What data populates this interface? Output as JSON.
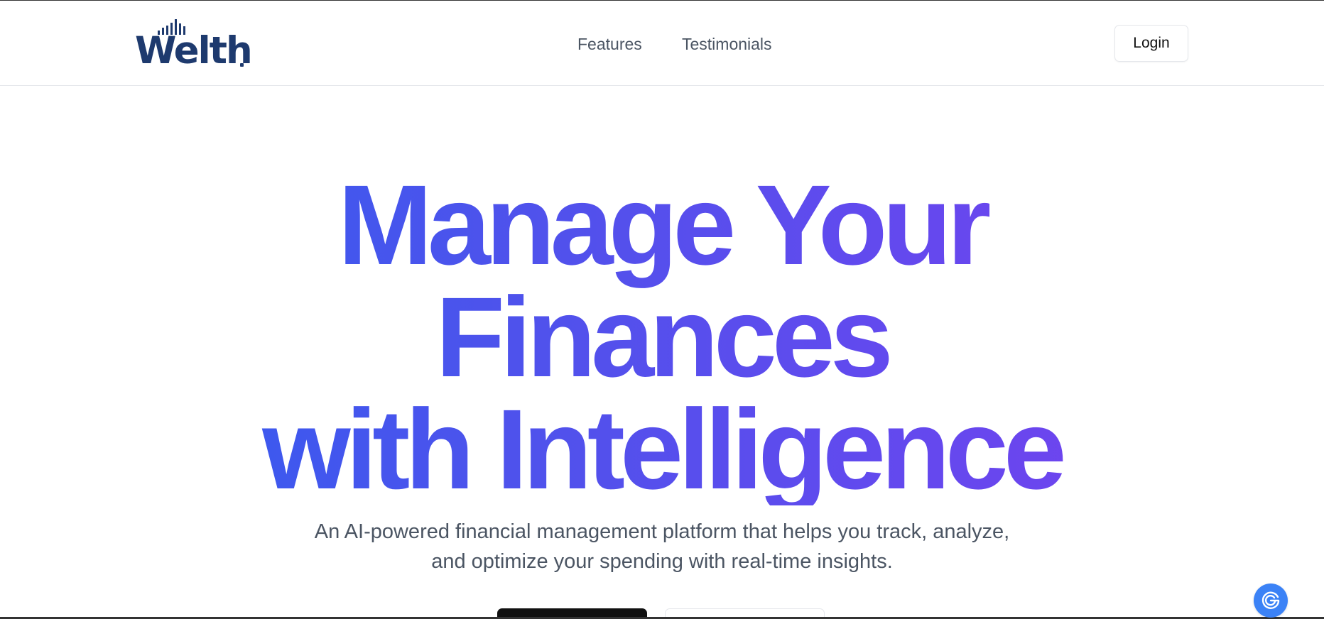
{
  "brand": {
    "name": "Welth",
    "logo_color": "#1e3a6e"
  },
  "nav": {
    "links": [
      {
        "label": "Features"
      },
      {
        "label": "Testimonials"
      }
    ],
    "login_label": "Login"
  },
  "hero": {
    "title_lines": [
      "Manage Your",
      "Finances",
      "with Intelligence"
    ],
    "subtitle": "An AI-powered financial management platform that helps you track, analyze, and optimize your spending with real-time insights.",
    "gradient_colors": [
      "#2d5ef0",
      "#4f52ec",
      "#7a3ff0"
    ]
  },
  "floating_button": {
    "icon": "assistant-icon",
    "color": "#3b82f6"
  }
}
